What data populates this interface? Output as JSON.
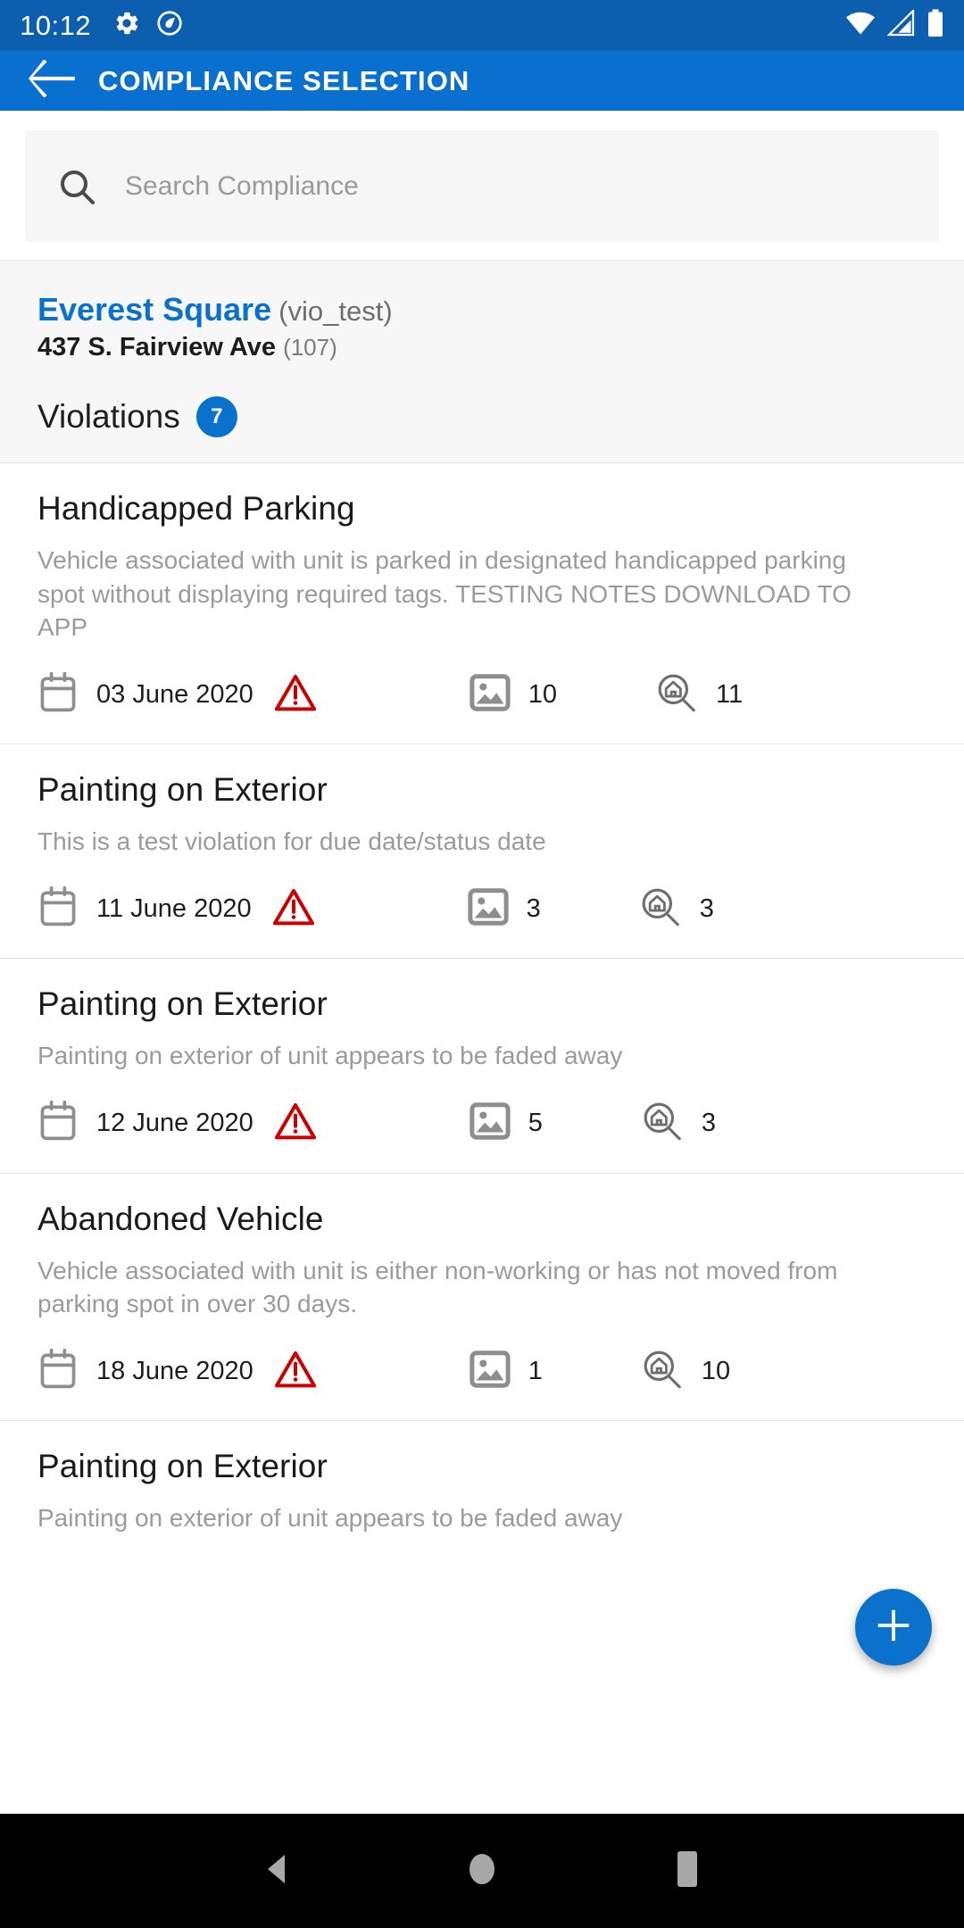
{
  "status_bar": {
    "time": "10:12",
    "icons": [
      "gear-icon",
      "location-circle-icon",
      "wifi-icon",
      "cell-signal-icon",
      "battery-icon"
    ],
    "background_color": "#0b5fae"
  },
  "app_bar": {
    "title": "COMPLIANCE SELECTION",
    "back_icon": "back-arrow-icon",
    "background_color": "#0a70cf"
  },
  "search": {
    "placeholder": "Search Compliance",
    "value": "",
    "icon": "search-icon"
  },
  "property": {
    "name": "Everest Square",
    "code": "(vio_test)",
    "address": "437 S. Fairview Ave",
    "unit": "(107)",
    "name_color": "#0a72cc"
  },
  "violations_header": {
    "label": "Violations",
    "count": "7",
    "badge_color": "#0a72cc"
  },
  "violations": [
    {
      "title": "Handicapped Parking",
      "description": "Vehicle associated with unit is parked in designated handicapped parking spot without displaying required tags. TESTING NOTES DOWNLOAD TO APP",
      "date": "03 June 2020",
      "warning": true,
      "photo_count": "10",
      "inspection_count": "11"
    },
    {
      "title": "Painting on Exterior",
      "description": "This is a test violation for due date/status date",
      "date": "11 June 2020",
      "warning": true,
      "photo_count": "3",
      "inspection_count": "3"
    },
    {
      "title": "Painting on Exterior",
      "description": "Painting on exterior of unit appears to be faded away",
      "date": "12 June 2020",
      "warning": true,
      "photo_count": "5",
      "inspection_count": "3"
    },
    {
      "title": "Abandoned Vehicle",
      "description": "Vehicle associated with unit is either non-working or has not moved from parking spot in over 30 days.",
      "date": "18 June 2020",
      "warning": true,
      "photo_count": "1",
      "inspection_count": "10"
    },
    {
      "title": "Painting on Exterior",
      "description": "Painting on exterior of unit appears to be faded away",
      "date": "",
      "warning": false,
      "photo_count": "",
      "inspection_count": ""
    }
  ],
  "fab": {
    "icon": "plus-icon",
    "color": "#0a72cc"
  },
  "nav_bar": {
    "back_icon": "nav-back-triangle-icon",
    "home_icon": "nav-home-circle-icon",
    "recents_icon": "nav-recents-square-icon",
    "background_color": "#000000"
  },
  "icon_names": {
    "calendar": "calendar-icon",
    "warning": "warning-triangle-icon",
    "photo": "photo-icon",
    "inspection": "inspection-magnifier-house-icon"
  }
}
